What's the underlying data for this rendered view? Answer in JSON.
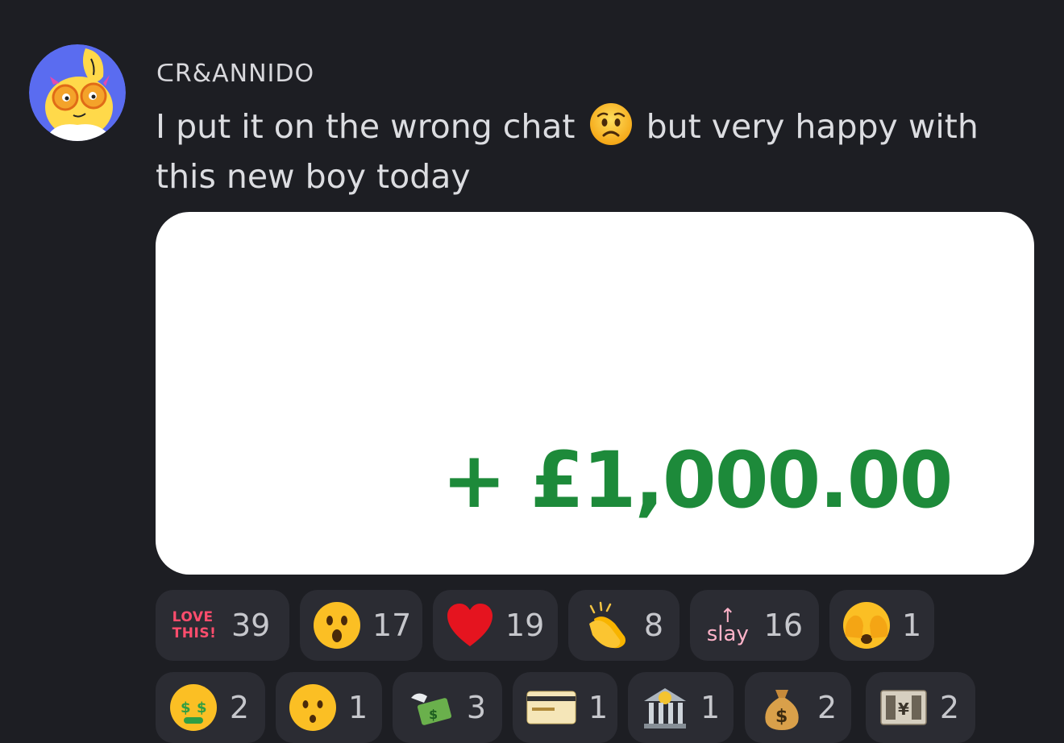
{
  "message": {
    "username": "ᑕR&ANNIDO",
    "text_before": "I put it on the wrong chat",
    "text_after": "but very happy with this new boy today",
    "inline_emoji": "worried-face-emoji",
    "attachment": {
      "amount": "+ £1,000.00"
    }
  },
  "reactions": {
    "row1": [
      {
        "icon": "love-this-sticker",
        "label": "LOVE THIS!",
        "count": "39"
      },
      {
        "icon": "astonished-face-emoji",
        "count": "17"
      },
      {
        "icon": "red-heart-emoji",
        "count": "19"
      },
      {
        "icon": "clapping-hands-emoji",
        "count": "8"
      },
      {
        "icon": "slay-sticker",
        "label": "slay",
        "count": "16"
      },
      {
        "icon": "face-with-hands-over-eyes-emoji",
        "count": "1"
      }
    ],
    "row2": [
      {
        "icon": "money-mouth-face-emoji",
        "count": "2"
      },
      {
        "icon": "hushed-face-emoji",
        "count": "1"
      },
      {
        "icon": "money-with-wings-emoji",
        "count": "3"
      },
      {
        "icon": "credit-card-emoji",
        "count": "1"
      },
      {
        "icon": "bank-emoji",
        "count": "1"
      },
      {
        "icon": "money-bag-emoji",
        "count": "2"
      },
      {
        "icon": "yen-banknote-emoji",
        "count": "2"
      }
    ]
  },
  "colors": {
    "background": "#1d1e23",
    "reaction_bg": "#2b2c33",
    "amount_green": "#1d8a3a",
    "love_pink": "#ff4d6d"
  }
}
